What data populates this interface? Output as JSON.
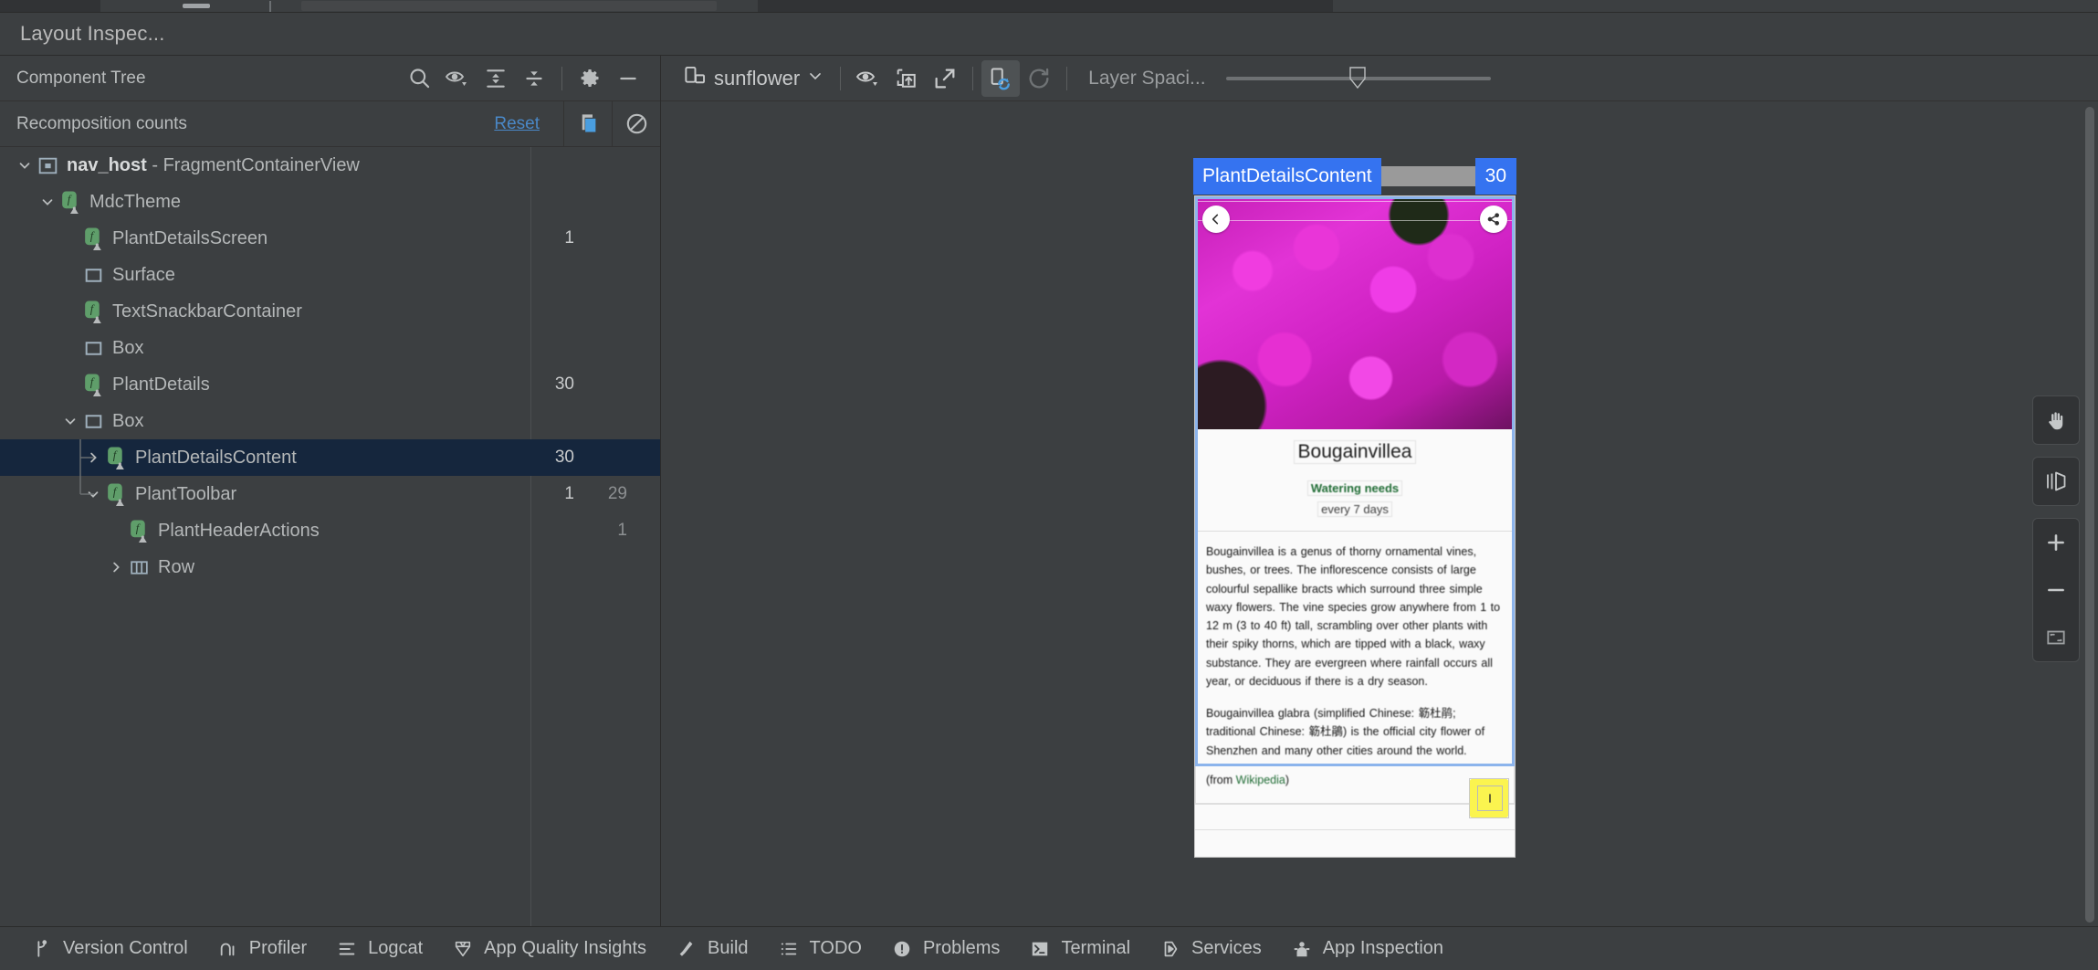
{
  "window": {
    "tool_window_title": "Layout Inspec..."
  },
  "tree_panel": {
    "header_label": "Component Tree",
    "toolbar_icons": [
      {
        "name": "search-icon",
        "title": "Search"
      },
      {
        "name": "eye-visibility-icon",
        "title": "Toggle visibility"
      },
      {
        "name": "expand-all-icon",
        "title": "Expand All"
      },
      {
        "name": "collapse-all-icon",
        "title": "Collapse All"
      },
      {
        "name": "gear-settings-icon",
        "title": "Settings"
      },
      {
        "name": "minimize-icon",
        "title": "Hide"
      }
    ],
    "recomposition": {
      "label": "Recomposition counts",
      "reset_label": "Reset",
      "buttons": [
        {
          "name": "copy-counts-icon",
          "title": "Copy"
        },
        {
          "name": "no-entry-icon",
          "title": "Stop counting"
        }
      ]
    },
    "columns": [
      "name",
      "count",
      "skipped"
    ],
    "rows": [
      {
        "indent": 0,
        "twisty": "down",
        "icon": "fragment-container-view-icon",
        "label_bold": "nav_host",
        "label_rest": " - FragmentContainerView",
        "count": "",
        "skipped": "",
        "selected": false,
        "guide": "none"
      },
      {
        "indent": 1,
        "twisty": "down",
        "icon": "composable-icon",
        "label_bold": "",
        "label_rest": "MdcTheme",
        "count": "",
        "skipped": "",
        "selected": false,
        "guide": "none"
      },
      {
        "indent": 2,
        "twisty": "none",
        "icon": "composable-icon",
        "label_bold": "",
        "label_rest": "PlantDetailsScreen",
        "count": "1",
        "skipped": "",
        "selected": false,
        "guide": "none"
      },
      {
        "indent": 2,
        "twisty": "none",
        "icon": "box-icon",
        "label_bold": "",
        "label_rest": "Surface",
        "count": "",
        "skipped": "",
        "selected": false,
        "guide": "none"
      },
      {
        "indent": 2,
        "twisty": "none",
        "icon": "composable-icon",
        "label_bold": "",
        "label_rest": "TextSnackbarContainer",
        "count": "",
        "skipped": "",
        "selected": false,
        "guide": "none"
      },
      {
        "indent": 2,
        "twisty": "none",
        "icon": "box-icon",
        "label_bold": "",
        "label_rest": "Box",
        "count": "",
        "skipped": "",
        "selected": false,
        "guide": "none"
      },
      {
        "indent": 2,
        "twisty": "none",
        "icon": "composable-icon",
        "label_bold": "",
        "label_rest": "PlantDetails",
        "count": "30",
        "skipped": "",
        "selected": false,
        "guide": "none"
      },
      {
        "indent": 2,
        "twisty": "down",
        "icon": "box-icon",
        "label_bold": "",
        "label_rest": "Box",
        "count": "",
        "skipped": "",
        "selected": false,
        "guide": "none"
      },
      {
        "indent": 3,
        "twisty": "right",
        "icon": "composable-icon",
        "label_bold": "",
        "label_rest": "PlantDetailsContent",
        "count": "30",
        "skipped": "",
        "selected": true,
        "guide": "tee"
      },
      {
        "indent": 3,
        "twisty": "down",
        "icon": "composable-icon",
        "label_bold": "",
        "label_rest": "PlantToolbar",
        "count": "1",
        "skipped": "29",
        "selected": false,
        "guide": "end"
      },
      {
        "indent": 4,
        "twisty": "none",
        "icon": "composable-icon",
        "label_bold": "",
        "label_rest": "PlantHeaderActions",
        "count": "",
        "skipped": "1",
        "selected": false,
        "guide": "none"
      },
      {
        "indent": 4,
        "twisty": "right",
        "icon": "row-icon",
        "label_bold": "",
        "label_rest": "Row",
        "count": "",
        "skipped": "",
        "selected": false,
        "guide": "none"
      }
    ]
  },
  "render_toolbar": {
    "process_combo": {
      "label": "sunflower",
      "icon": "device-icon",
      "chevron": "chevron-down-icon"
    },
    "buttons": [
      {
        "name": "eye-visibility-icon",
        "title": "View options",
        "active": false
      },
      {
        "name": "overlay-image-icon",
        "title": "Load overlay",
        "active": false
      },
      {
        "name": "open-external-icon",
        "title": "Open in new window",
        "active": false
      },
      {
        "name": "live-updates-icon",
        "title": "Live updates",
        "active": true
      },
      {
        "name": "refresh-icon",
        "title": "Refresh",
        "active": false
      }
    ],
    "layer_spacing_label": "Layer Spaci...",
    "layer_spacing_value": 46
  },
  "device_preview": {
    "selected_node_label": "PlantDetailsContent",
    "selected_node_count": "30",
    "toolbar_icons": [
      {
        "name": "back-arrow-icon"
      },
      {
        "name": "share-icon"
      }
    ],
    "fab_icon": "add-plant-icon",
    "plant_title": "Bougainvillea",
    "watering_label": "Watering needs",
    "watering_value": "every 7 days",
    "description_p1": "Bougainvillea is a genus of thorny ornamental vines, bushes, or trees. The inflorescence consists of large colourful sepallike bracts which surround three simple waxy flowers. The vine species grow anywhere from 1 to 12 m (3 to 40 ft) tall, scrambling over other plants with their spiky thorns, which are tipped with a black, waxy substance. They are evergreen where rainfall occurs all year, or deciduous if there is a dry season.",
    "description_p2": "Bougainvillea glabra (simplified Chinese: 簕杜鹃; traditional Chinese: 簕杜鵑) is the official city flower of Shenzhen and many other cities around the world.",
    "source_prefix": "(from ",
    "source_link": "Wikipedia",
    "source_suffix": ")"
  },
  "floating_tools": [
    {
      "name": "pan-hand-icon",
      "title": "Pan"
    },
    {
      "name": "rotate-3d-icon",
      "title": "3D mode"
    },
    {
      "name": "zoom-in-icon",
      "title": "Zoom in"
    },
    {
      "name": "zoom-out-icon",
      "title": "Zoom out"
    },
    {
      "name": "fit-to-screen-icon",
      "title": "Fit to screen"
    }
  ],
  "status_bar": [
    {
      "label": "Version Control",
      "icon": "branch-icon"
    },
    {
      "label": "Profiler",
      "icon": "profiler-icon"
    },
    {
      "label": "Logcat",
      "icon": "logcat-icon"
    },
    {
      "label": "App Quality Insights",
      "icon": "diamond-icon"
    },
    {
      "label": "Build",
      "icon": "hammer-icon"
    },
    {
      "label": "TODO",
      "icon": "list-icon"
    },
    {
      "label": "Problems",
      "icon": "warning-icon"
    },
    {
      "label": "Terminal",
      "icon": "terminal-icon"
    },
    {
      "label": "Services",
      "icon": "play-hex-icon"
    },
    {
      "label": "App Inspection",
      "icon": "inspection-icon"
    }
  ],
  "colors": {
    "accent_blue": "#3573f0",
    "link_blue": "#4a88c7",
    "selection_navy": "#15263d",
    "panel_bg": "#3c3f41",
    "composable_green": "#5f9e6a",
    "highlight_yellow": "#fbf44f"
  }
}
